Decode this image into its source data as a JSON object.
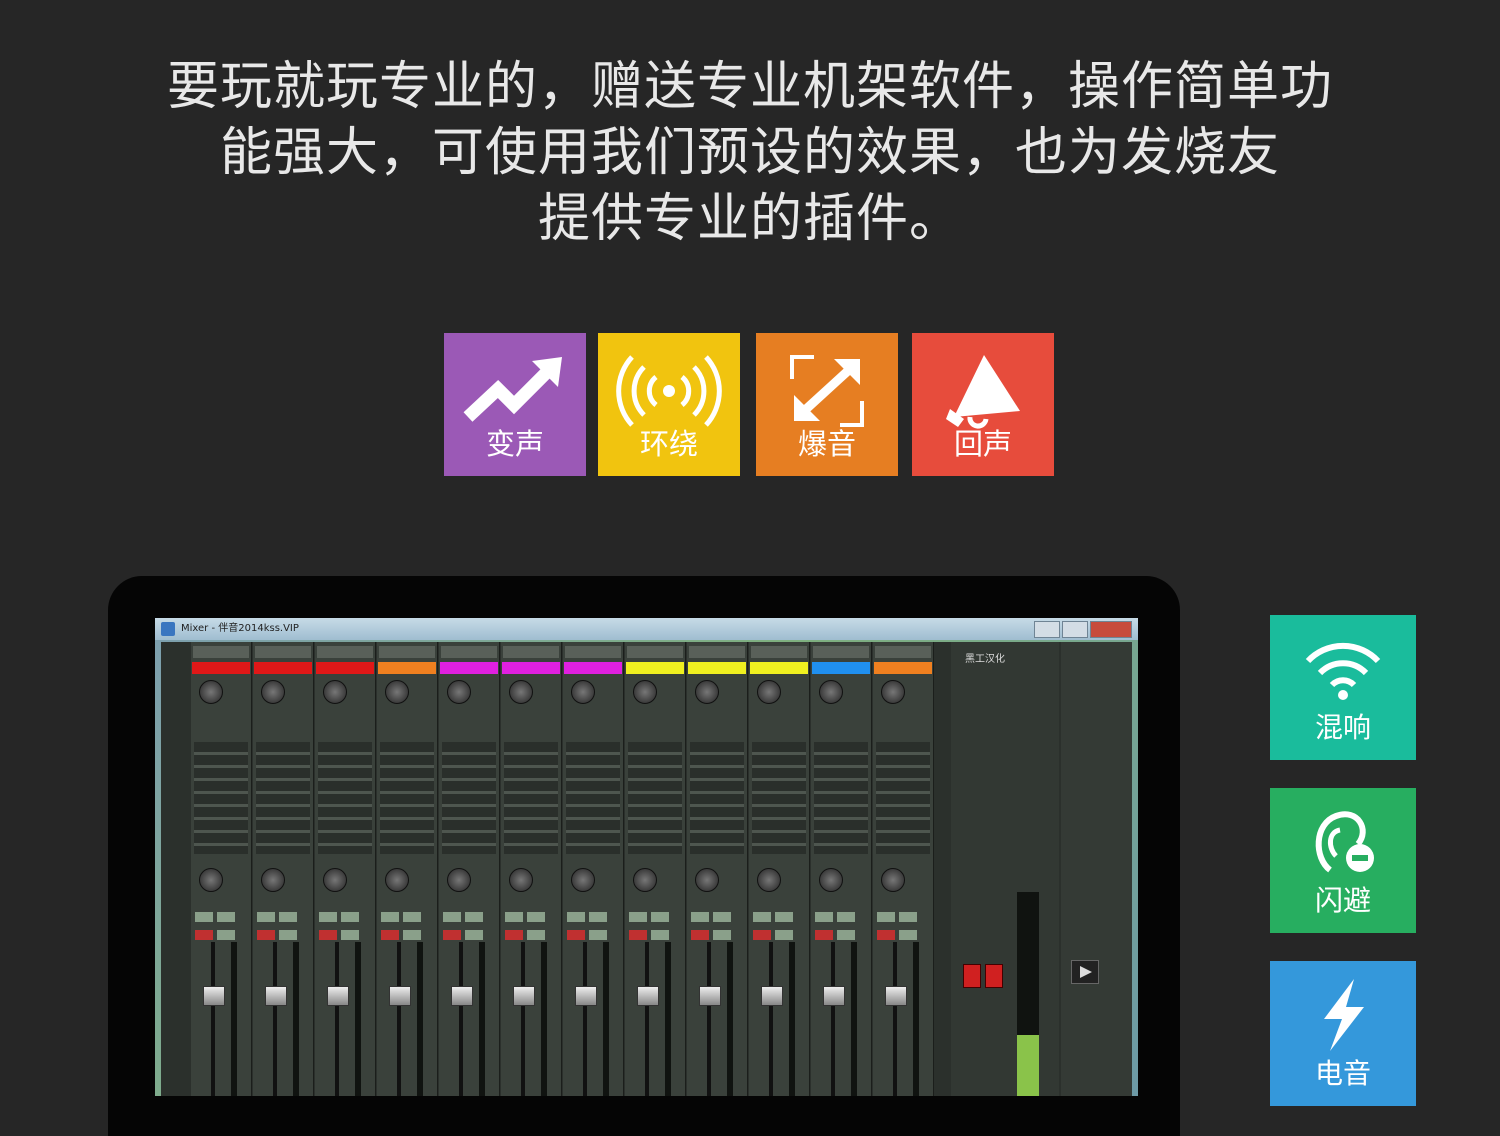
{
  "headline": {
    "line1": "要玩就玩专业的，赠送专业机架软件，操作简单功",
    "line2": "能强大，可使用我们预设的效果，也为发烧友",
    "line3": "提供专业的插件。"
  },
  "effects": [
    {
      "label": "变声",
      "icon": "trend-up-arrow-icon",
      "color": "#9b59b6"
    },
    {
      "label": "环绕",
      "icon": "broadcast-icon",
      "color": "#f1c40f"
    },
    {
      "label": "爆音",
      "icon": "expand-arrows-icon",
      "color": "#e67e22"
    },
    {
      "label": "回声",
      "icon": "megaphone-icon",
      "color": "#e74c3c"
    }
  ],
  "side_effects": [
    {
      "label": "混响",
      "icon": "wifi-icon",
      "color": "#1abc9c"
    },
    {
      "label": "闪避",
      "icon": "ear-minus-icon",
      "color": "#27ae60"
    },
    {
      "label": "电音",
      "icon": "lightning-icon",
      "color": "#3498db"
    }
  ],
  "mixer_window": {
    "title": "Mixer - 伴音2014kss.VIP",
    "master_label": "黑工汉化",
    "channel_colors": [
      "#e01818",
      "#e01818",
      "#e01818",
      "#f08020",
      "#e020e0",
      "#e020e0",
      "#e020e0",
      "#f0f020",
      "#f0f020",
      "#f0f020",
      "#2090f0",
      "#f08020"
    ]
  }
}
